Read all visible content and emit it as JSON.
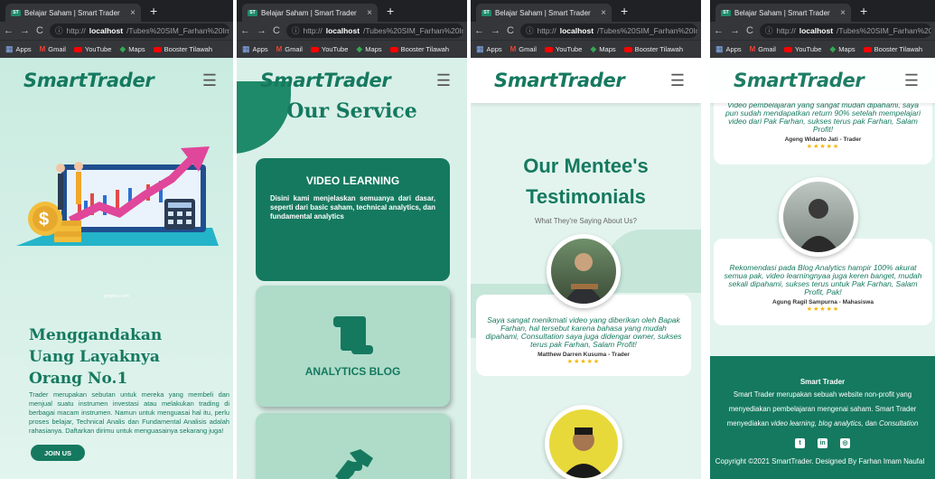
{
  "browser": {
    "tab_title": "Belajar Saham | Smart Trader",
    "tab_close": "×",
    "new_tab": "+",
    "url_prefix": "http://",
    "url_host": "localhost",
    "url_path": "/Tubes%20SIM_Farhan%20Imam",
    "bookmarks": [
      "Apps",
      "Gmail",
      "YouTube",
      "Maps",
      "Booster Tilawah"
    ]
  },
  "site": {
    "logo": "SmartTrader",
    "menu_icon": "hamburger-menu"
  },
  "screen1": {
    "caption": "pngtree.com",
    "headline": [
      "Menggandakan",
      "Uang Layaknya",
      "Orang No.1"
    ],
    "text": "Trader merupakan sebutan untuk mereka yang membeli dan menjual suatu instrumen investasi atau melakukan trading di berbagai macam instrumen. Namun untuk menguasai hal itu, perlu proses belajar, Technical Analis dan Fundamental Analisis adalah rahasianya. Daftarkan dirimu untuk menguasainya sekarang juga!",
    "cta": "JOIN US"
  },
  "screen2": {
    "title": "Our Service",
    "cards": [
      {
        "title": "VIDEO LEARNING",
        "text": "Disini kami menjelaskan semuanya dari dasar, seperti dari basic saham, technical analytics, dan fundamental analytics"
      },
      {
        "title": "ANALYTICS BLOG"
      }
    ]
  },
  "screen3": {
    "title_line1": "Our Mentee's",
    "title_line2": "Testimonials",
    "subtitle": "What They're Saying About Us?",
    "testimonial": {
      "quote": "Saya sangat menikmati video yang diberikan oleh Bapak Farhan, hal tersebut karena bahasa yang mudah dipahami, Consultation saya juga didengar owner, sukses terus pak Farhan, Salam Profit!",
      "name": "Matthew Darren Kusuma - Trader",
      "stars": "★★★★★"
    }
  },
  "screen4": {
    "testimonials": [
      {
        "quote": "Video pembelajaran yang sangat mudah dipahami, saya pun sudah mendapatkan return 90% setelah mempelajari video dari Pak Farhan, sukses terus pak Farhan, Salam Profit!",
        "name": "Ageng Widarto Jati - Trader",
        "stars": "★★★★★"
      },
      {
        "quote": "Rekomendasi pada Blog Analytics hampir 100% akurat semua pak, video learningnyaa juga keren banget, mudah sekali dipahami, sukses terus untuk Pak Farhan, Salam Profit, Pak!",
        "name": "Agung Ragil Sampurna - Mahasiswa",
        "stars": "★★★★★"
      }
    ],
    "footer": {
      "title": "Smart Trader",
      "text_plain": "Smart Trader merupakan sebuah website non-profit yang menyediakan pembelajaran mengenai saham. Smart Trader menyediakan",
      "text_italic1": "video learning, blog analytics,",
      "text_and": "dan",
      "text_italic2": "Consultation",
      "copyright": "Copyright ©2021 SmartTrader. Designed By Farhan Imam Naufal"
    }
  },
  "colors": {
    "brand": "#15795f",
    "background": "#d9f0e8",
    "stars": "#f5b400"
  }
}
